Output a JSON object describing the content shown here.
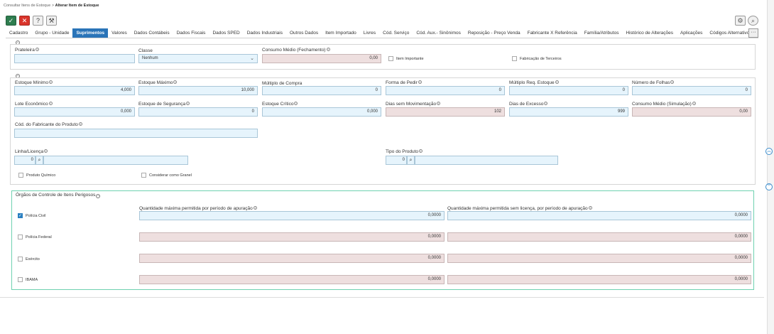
{
  "breadcrumb": {
    "parent": "Consultar Itens de Estoque",
    "separator": ">",
    "current": "Alterar Item de Estoque"
  },
  "toolbar": {
    "confirm_icon": "check-icon",
    "cancel_icon": "close-icon",
    "help_label": "?",
    "tool_icon": "wrench-icon"
  },
  "tabs": [
    "Cadastro",
    "Grupo - Unidade",
    "Suprimentos",
    "Valores",
    "Dados Contábeis",
    "Dados Fiscais",
    "Dados SPED",
    "Dados Industriais",
    "Outros Dados",
    "Item Importado",
    "Livres",
    "Cód. Serviço",
    "Cód. Aux.- Sinônimos",
    "Reposição - Preço Venda",
    "Fabricante X Referência",
    "Família/Atributos",
    "Histórico de Alterações",
    "Aplicações",
    "Códigos Alternativos"
  ],
  "tabs_more": "···",
  "section1": {
    "prateleira": {
      "label": "Prateleira",
      "value": ""
    },
    "classe": {
      "label": "Classe",
      "value": "Nenhum"
    },
    "consumo_medio_fech": {
      "label": "Consumo Médio (Fechamento)",
      "value": "0,00"
    },
    "item_importante": "Item Importante",
    "fabricacao_terceiros": "Fabricação de Terceiros"
  },
  "section2": {
    "estoque_minimo": {
      "label": "Estoque Mínimo",
      "value": "4,000"
    },
    "estoque_maximo": {
      "label": "Estoque Máximo",
      "value": "10,000"
    },
    "multiplo_compra": {
      "label": "Múltiplo de Compra",
      "value": "0"
    },
    "forma_pedir": {
      "label": "Forma de Pedir",
      "value": "0"
    },
    "multiplo_req": {
      "label": "Múltiplo Req. Estoque",
      "value": "0"
    },
    "numero_folhas": {
      "label": "Número de Folhas",
      "value": "0"
    },
    "lote_economico": {
      "label": "Lote Econômico",
      "value": "0,000"
    },
    "estoque_seguranca": {
      "label": "Estoque de Segurança",
      "value": "0"
    },
    "estoque_critico": {
      "label": "Estoque Crítico",
      "value": "0,000"
    },
    "dias_sem_mov": {
      "label": "Dias sem Movimentação",
      "value": "102"
    },
    "dias_excesso": {
      "label": "Dias de Excesso",
      "value": "999"
    },
    "consumo_medio_sim": {
      "label": "Consumo Médio (Simulação)",
      "value": "0,00"
    },
    "cod_fabricante": {
      "label": "Cód. do Fabricante do Produto",
      "value": ""
    },
    "linha_licenca": {
      "label": "Linha/Licença",
      "value": "0"
    },
    "tipo_produto": {
      "label": "Tipo do Produto",
      "value": "0"
    },
    "produto_quimico": "Produto Químico",
    "considerar_granel": "Considerar como Granel"
  },
  "orgaos": {
    "title": "Órgãos de Controle de Itens Perigosos",
    "col1": "Quantidade máxima permitida por período de apuração",
    "col2": "Quantidade máxima permitida sem licença, por período de apuração",
    "rows": [
      {
        "name": "Polícia Civil",
        "checked": true,
        "v1": "0,0000",
        "v2": "0,0000"
      },
      {
        "name": "Polícia Federal",
        "checked": false,
        "v1": "0,0000",
        "v2": "0,0000"
      },
      {
        "name": "Exército",
        "checked": false,
        "v1": "0,0000",
        "v2": "0,0000"
      },
      {
        "name": "IBAMA",
        "checked": false,
        "v1": "0,0000",
        "v2": "0,0000"
      }
    ]
  }
}
